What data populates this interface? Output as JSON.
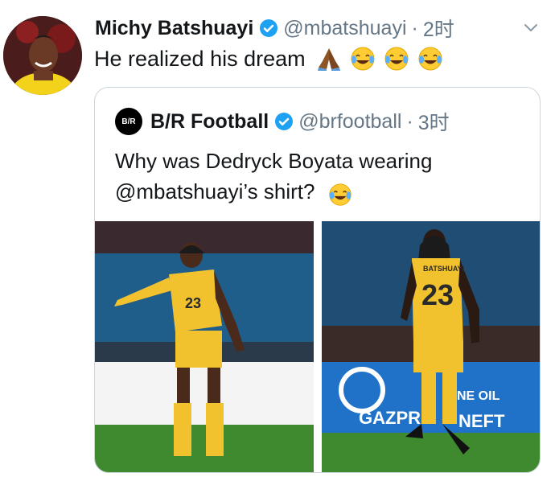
{
  "tweet": {
    "author_name": "Michy Batshuayi",
    "handle": "@mbatshuayi",
    "separator": "·",
    "time": "2时",
    "text": "He realized his dream",
    "emojis": [
      "folded-hands",
      "tears-of-joy",
      "tears-of-joy",
      "tears-of-joy"
    ]
  },
  "quoted_tweet": {
    "author_name": "B/R Football",
    "logo_text": "B/R",
    "handle": "@brfootball",
    "separator": "·",
    "time": "3时",
    "text": "Why was Dedryck Boyata wearing @mbatshuayi’s shirt?",
    "emoji": "tears-of-joy"
  },
  "photos": {
    "left": {
      "jersey_number": "23"
    },
    "right": {
      "jersey_number": "23",
      "jersey_name": "BATSHUAYI",
      "board_text_1": "NE OIL",
      "board_text_2": "GAZPR",
      "board_text_3": "NEFT"
    }
  },
  "colors": {
    "verified": "#1da1f2",
    "secondary_text": "#657786",
    "kit_yellow": "#f2c12e",
    "pitch_green": "#3f8a2e"
  }
}
